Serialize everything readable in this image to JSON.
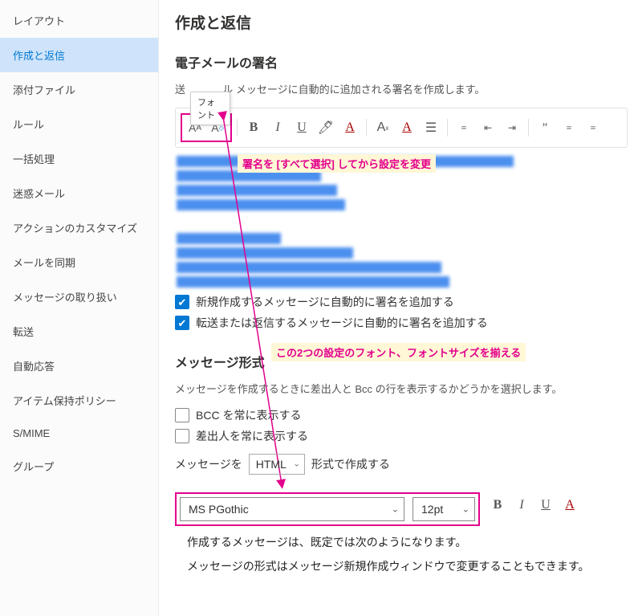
{
  "sidebar": {
    "items": [
      {
        "label": "レイアウト"
      },
      {
        "label": "作成と返信"
      },
      {
        "label": "添付ファイル"
      },
      {
        "label": "ルール"
      },
      {
        "label": "一括処理"
      },
      {
        "label": "迷惑メール"
      },
      {
        "label": "アクションのカスタマイズ"
      },
      {
        "label": "メールを同期"
      },
      {
        "label": "メッセージの取り扱い"
      },
      {
        "label": "転送"
      },
      {
        "label": "自動応答"
      },
      {
        "label": "アイテム保持ポリシー"
      },
      {
        "label": "S/MIME"
      },
      {
        "label": "グループ"
      }
    ],
    "active_index": 1
  },
  "main": {
    "title": "作成と返信",
    "signature": {
      "heading": "電子メールの署名",
      "desc_prefix": "送",
      "desc_suffix": "ル メッセージに自動的に追加される署名を作成します。",
      "font_tooltip": "フォント",
      "callout1": "署名を [すべて選択] してから設定を変更",
      "cb1_label": "新規作成するメッセージに自動的に署名を追加する",
      "cb2_label": "転送または返信するメッセージに自動的に署名を追加する"
    },
    "callout2": "この2つの設定のフォント、フォントサイズを揃える",
    "format": {
      "heading": "メッセージ形式",
      "desc": "メッセージを作成するときに差出人と Bcc の行を表示するかどうかを選択します。",
      "cb_bcc": "BCC を常に表示する",
      "cb_from": "差出人を常に表示する",
      "compose_prefix": "メッセージを",
      "compose_value": "HTML",
      "compose_suffix": "形式で作成する",
      "font_value": "MS PGothic",
      "size_value": "12pt",
      "note1": "作成するメッセージは、既定では次のようになります。",
      "note2": "メッセージの形式はメッセージ新規作成ウィンドウで変更することもできます。"
    }
  }
}
